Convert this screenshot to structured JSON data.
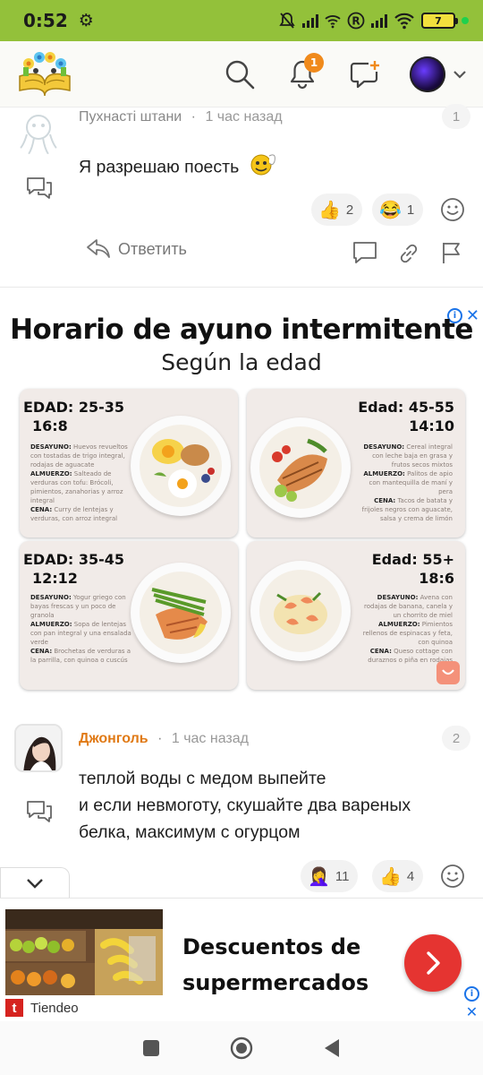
{
  "status_bar": {
    "time": "0:52",
    "battery": "7"
  },
  "header": {
    "notification_count": "1"
  },
  "comments": [
    {
      "author": "Пухнасті штани",
      "meta": "1 час назад",
      "number": "1",
      "text": "Я разрешаю поесть",
      "reactions": [
        {
          "icon": "thumbs-up",
          "emoji": "👍",
          "count": "2"
        },
        {
          "icon": "laughing",
          "emoji": "😂",
          "count": "1"
        }
      ],
      "reply_label": "Ответить"
    },
    {
      "author": "Джонголь",
      "meta": "1 час назад",
      "number": "2",
      "text_lines": [
        "теплой воды с медом выпейте",
        "и если невмоготу, скушайте два вареных",
        "белка, максимум с огурцом"
      ],
      "reactions": [
        {
          "icon": "facepalm",
          "emoji": "🤦‍♀️",
          "count": "11"
        },
        {
          "icon": "thumbs-up",
          "emoji": "👍",
          "count": "4"
        }
      ]
    }
  ],
  "ad_image": {
    "title": "Horario de ayuno intermitente",
    "subtitle": "Según la edad",
    "cards": [
      {
        "age": "EDAD: 25-35",
        "ratio": "16:8",
        "lines": [
          {
            "label": "DESAYUNO:",
            "text": "Huevos revueltos con tostadas de trigo integral, rodajas de aguacate"
          },
          {
            "label": "ALMUERZO:",
            "text": "Salteado de verduras con tofu: Brócoli, pimientos, zanahorias y arroz integral"
          },
          {
            "label": "CENA:",
            "text": "Curry de lentejas y verduras, con arroz integral"
          }
        ]
      },
      {
        "age": "Edad: 45-55",
        "ratio": "14:10",
        "lines": [
          {
            "label": "DESAYUNO:",
            "text": "Cereal integral con leche baja en grasa y frutos secos mixtos"
          },
          {
            "label": "ALMUERZO:",
            "text": "Palitos de apio con mantequilla de maní y pera"
          },
          {
            "label": "CENA:",
            "text": "Tacos de batata y frijoles negros con aguacate, salsa y crema de limón"
          }
        ]
      },
      {
        "age": "EDAD: 35-45",
        "ratio": "12:12",
        "lines": [
          {
            "label": "DESAYUNO:",
            "text": "Yogur griego con bayas frescas y un poco de granola"
          },
          {
            "label": "ALMUERZO:",
            "text": "Sopa de lentejas con pan integral y una ensalada verde"
          },
          {
            "label": "CENA:",
            "text": "Brochetas de verduras a la parrilla, con quinoa o cuscús"
          }
        ]
      },
      {
        "age": "Edad: 55+",
        "ratio": "18:6",
        "lines": [
          {
            "label": "DESAYUNO:",
            "text": "Avena con rodajas de banana, canela y un chorrito de miel"
          },
          {
            "label": "ALMUERZO:",
            "text": "Pimientos rellenos de espinacas y feta, con quinoa"
          },
          {
            "label": "CENA:",
            "text": "Queso cottage con duraznos o piña en rodajas"
          }
        ]
      }
    ]
  },
  "banner": {
    "headline": "Descuentos de supermercados",
    "brand": "Tiendeo"
  },
  "colors": {
    "status_bar": "#93c13a",
    "accent_orange": "#f08a1c",
    "author_orange": "#e07a16",
    "ad_button": "#e53431"
  }
}
